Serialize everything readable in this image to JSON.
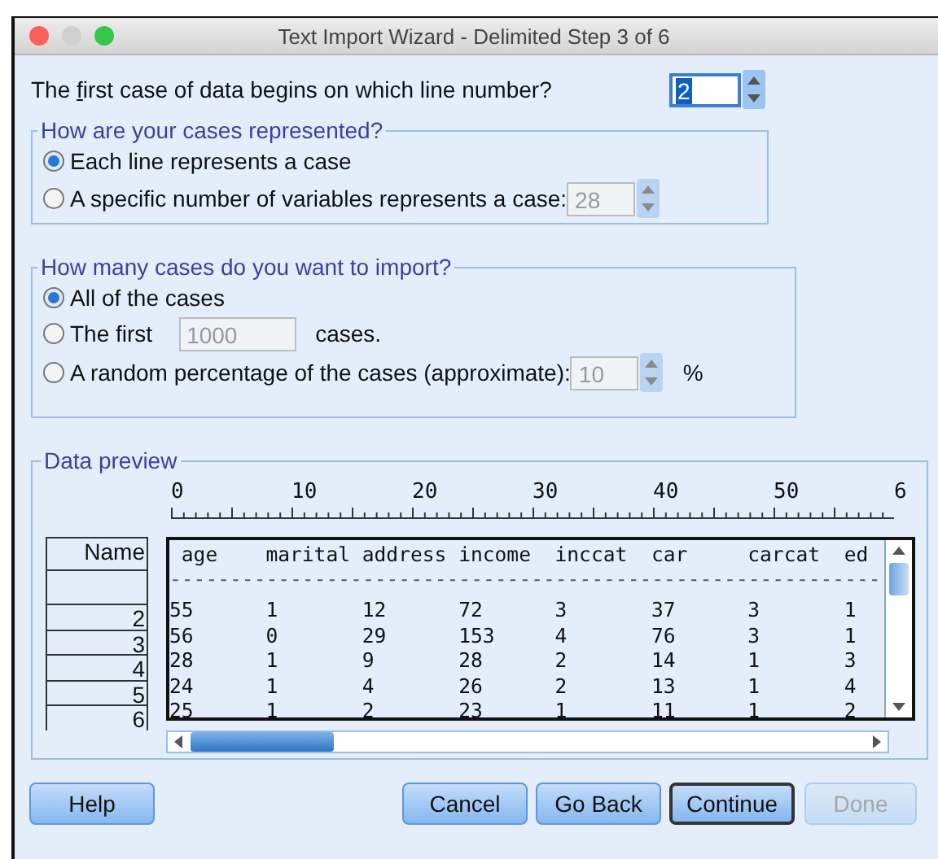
{
  "window": {
    "title": "Text Import Wizard - Delimited Step 3 of 6"
  },
  "first_line": {
    "label_before": "The ",
    "mnemonic": "f",
    "label_after": "irst case of data begins on which line number?",
    "value": "2"
  },
  "representation": {
    "title": "How are your cases represented?",
    "options": [
      {
        "label": "Each line represents a case",
        "selected": true
      },
      {
        "label": "A specific number of variables represents a case:",
        "selected": false,
        "field": "28",
        "kind": "spinner"
      }
    ]
  },
  "import": {
    "title": "How many cases do you want to import?",
    "options": [
      {
        "label": "All of the cases",
        "selected": true
      },
      {
        "label": "The first",
        "selected": false,
        "field": "1000",
        "kind": "field",
        "suffix": "cases."
      },
      {
        "label": "A random percentage of the cases (approximate):",
        "selected": false,
        "field": "10",
        "kind": "spinner",
        "suffix": "%"
      }
    ]
  },
  "preview": {
    "title": "Data preview",
    "ruler": [
      "0",
      "10",
      "20",
      "30",
      "40",
      "50",
      "6"
    ],
    "name_header": "Name",
    "row_names": [
      "2",
      "3",
      "4",
      "5",
      "6"
    ],
    "columns": [
      "age",
      "marital",
      "address",
      "income",
      "inccat",
      "car",
      "carcat",
      "ed"
    ],
    "separator": "-----------------------------------------------------------",
    "rows": [
      [
        "55",
        "1",
        "12",
        "72",
        "3",
        "37",
        "3",
        "1"
      ],
      [
        "56",
        "0",
        "29",
        "153",
        "4",
        "76",
        "3",
        "1"
      ],
      [
        "28",
        "1",
        "9",
        "28",
        "2",
        "14",
        "1",
        "3"
      ],
      [
        "24",
        "1",
        "4",
        "26",
        "2",
        "13",
        "1",
        "4"
      ],
      [
        "25",
        "1",
        "2",
        "23",
        "1",
        "11",
        "1",
        "2"
      ]
    ]
  },
  "buttons": [
    {
      "label": "Help",
      "kind": "help",
      "default": false,
      "disabled": false
    },
    {
      "label": "Cancel",
      "kind": "action",
      "default": false,
      "disabled": false
    },
    {
      "label": "Go Back",
      "kind": "action",
      "default": false,
      "disabled": false
    },
    {
      "label": "Continue",
      "kind": "action",
      "default": true,
      "disabled": false
    },
    {
      "label": "Done",
      "kind": "action",
      "default": false,
      "disabled": true
    }
  ]
}
